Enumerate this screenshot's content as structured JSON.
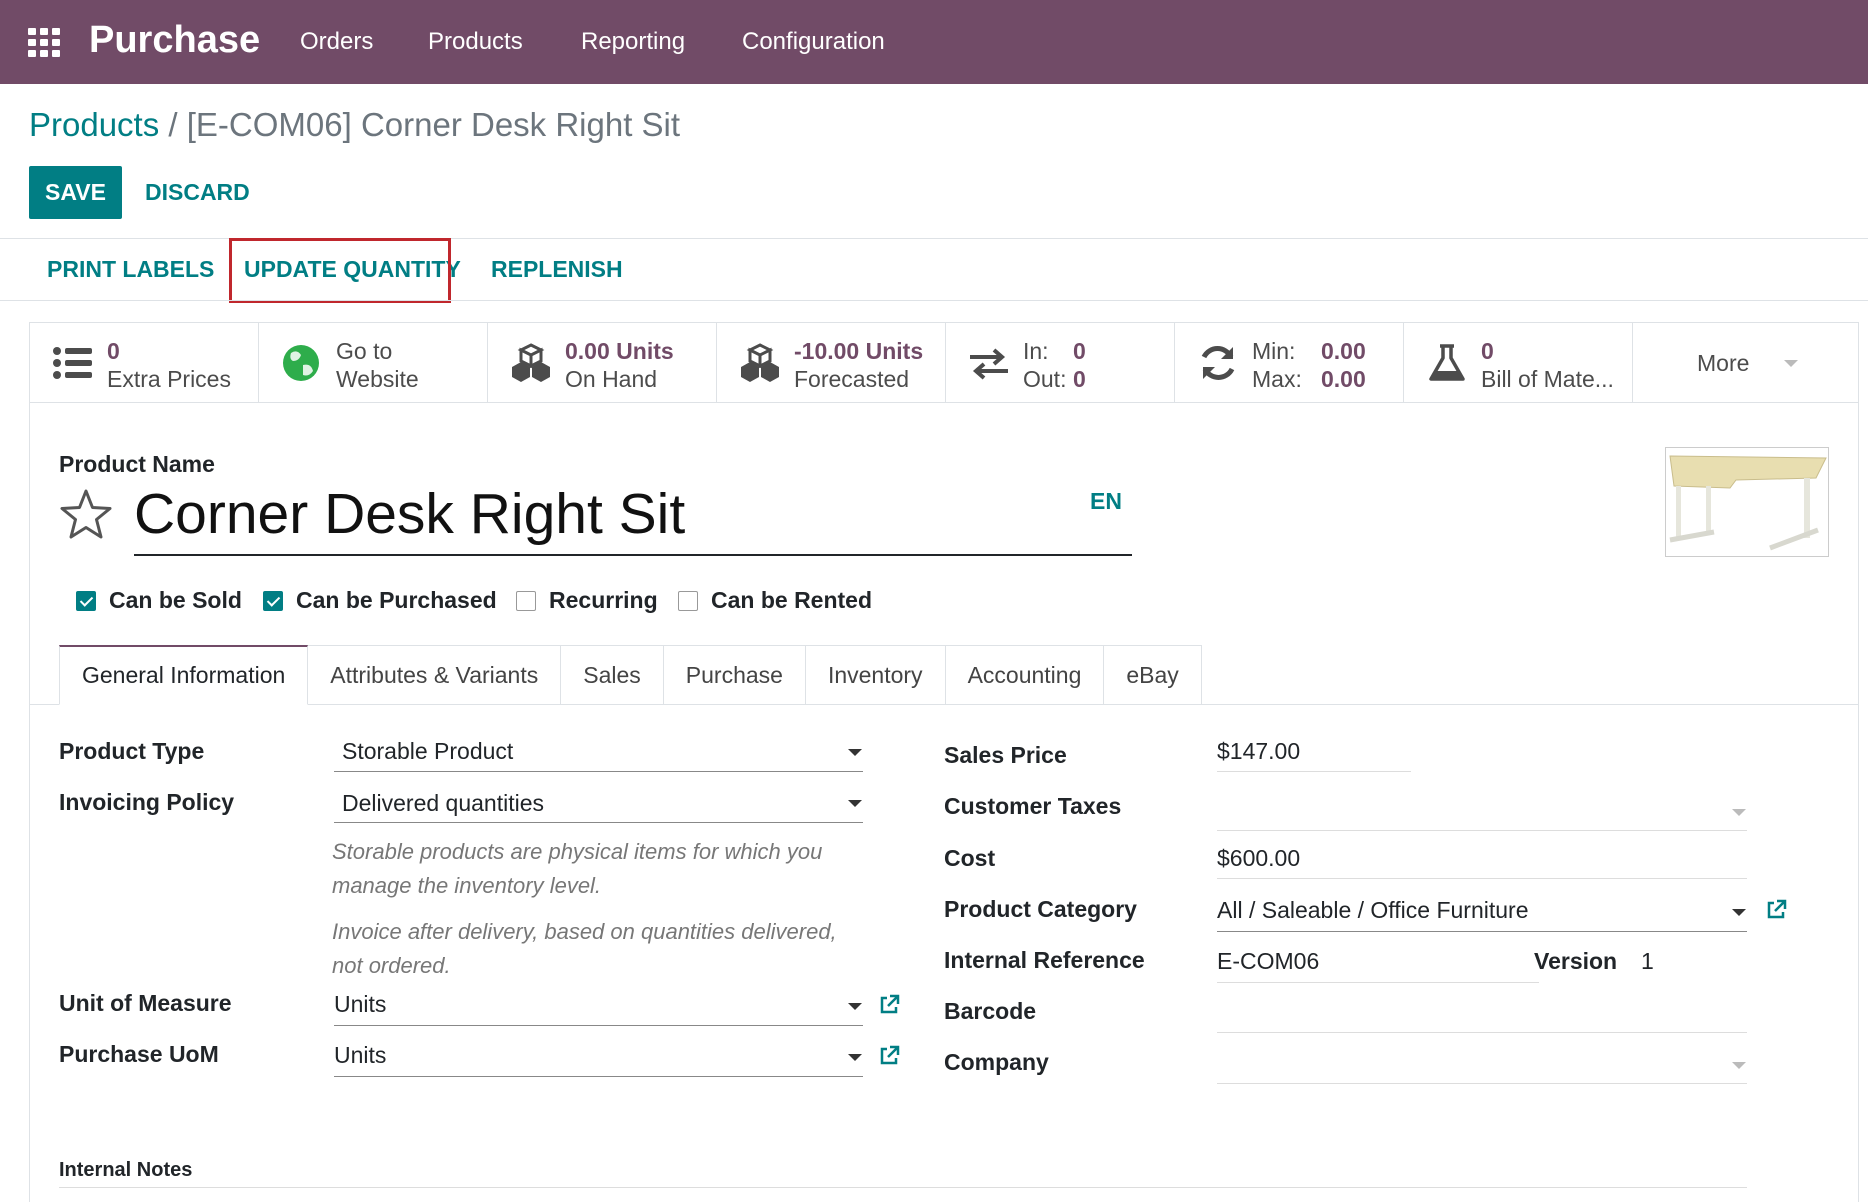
{
  "navbar": {
    "app_name": "Purchase",
    "menu": [
      "Orders",
      "Products",
      "Reporting",
      "Configuration"
    ]
  },
  "breadcrumb": {
    "parent": "Products",
    "separator": " / ",
    "current": "[E-COM06] Corner Desk Right Sit"
  },
  "buttons": {
    "save": "SAVE",
    "discard": "DISCARD"
  },
  "actions": {
    "print_labels": "PRINT LABELS",
    "update_quantity": "UPDATE QUANTITY",
    "replenish": "REPLENISH"
  },
  "stat_buttons": {
    "extra_prices": {
      "value": "0",
      "label": "Extra Prices"
    },
    "website": {
      "line1": "Go to",
      "line2": "Website"
    },
    "on_hand": {
      "value": "0.00 Units",
      "label": "On Hand"
    },
    "forecasted": {
      "value": "-10.00 Units",
      "label": "Forecasted"
    },
    "in_out": {
      "in_label": "In:",
      "out_label": "Out:",
      "in_value": "0",
      "out_value": "0"
    },
    "min_max": {
      "min_label": "Min:",
      "max_label": "Max:",
      "min_value": "0.00",
      "max_value": "0.00"
    },
    "bom": {
      "value": "0",
      "label": "Bill of Mate..."
    },
    "more": "More"
  },
  "product": {
    "name_label": "Product Name",
    "name": "Corner Desk Right Sit",
    "lang": "EN"
  },
  "checkboxes": [
    {
      "label": "Can be Sold",
      "checked": true
    },
    {
      "label": "Can be Purchased",
      "checked": true
    },
    {
      "label": "Recurring",
      "checked": false
    },
    {
      "label": "Can be Rented",
      "checked": false
    }
  ],
  "tabs": [
    "General Information",
    "Attributes & Variants",
    "Sales",
    "Purchase",
    "Inventory",
    "Accounting",
    "eBay"
  ],
  "active_tab": "General Information",
  "left_fields": {
    "product_type": {
      "label": "Product Type",
      "value": "Storable Product"
    },
    "invoicing_policy": {
      "label": "Invoicing Policy",
      "value": "Delivered quantities"
    },
    "help_type": "Storable products are physical items for which you manage the inventory level.",
    "help_invoice": "Invoice after delivery, based on quantities delivered, not ordered.",
    "uom": {
      "label": "Unit of Measure",
      "value": "Units"
    },
    "purchase_uom": {
      "label": "Purchase UoM",
      "value": "Units"
    }
  },
  "right_fields": {
    "sales_price": {
      "label": "Sales Price",
      "value": "$147.00"
    },
    "customer_taxes": {
      "label": "Customer Taxes",
      "value": ""
    },
    "cost": {
      "label": "Cost",
      "value": "$600.00"
    },
    "category": {
      "label": "Product Category",
      "value": "All / Saleable / Office Furniture"
    },
    "internal_ref": {
      "label": "Internal Reference",
      "value": "E-COM06"
    },
    "version": {
      "label": "Version",
      "value": "1"
    },
    "barcode": {
      "label": "Barcode",
      "value": ""
    },
    "company": {
      "label": "Company",
      "value": ""
    }
  },
  "internal_notes_label": "Internal Notes",
  "colors": {
    "brand": "#714B67",
    "accent": "#017E84",
    "highlight": "#C0272D"
  }
}
